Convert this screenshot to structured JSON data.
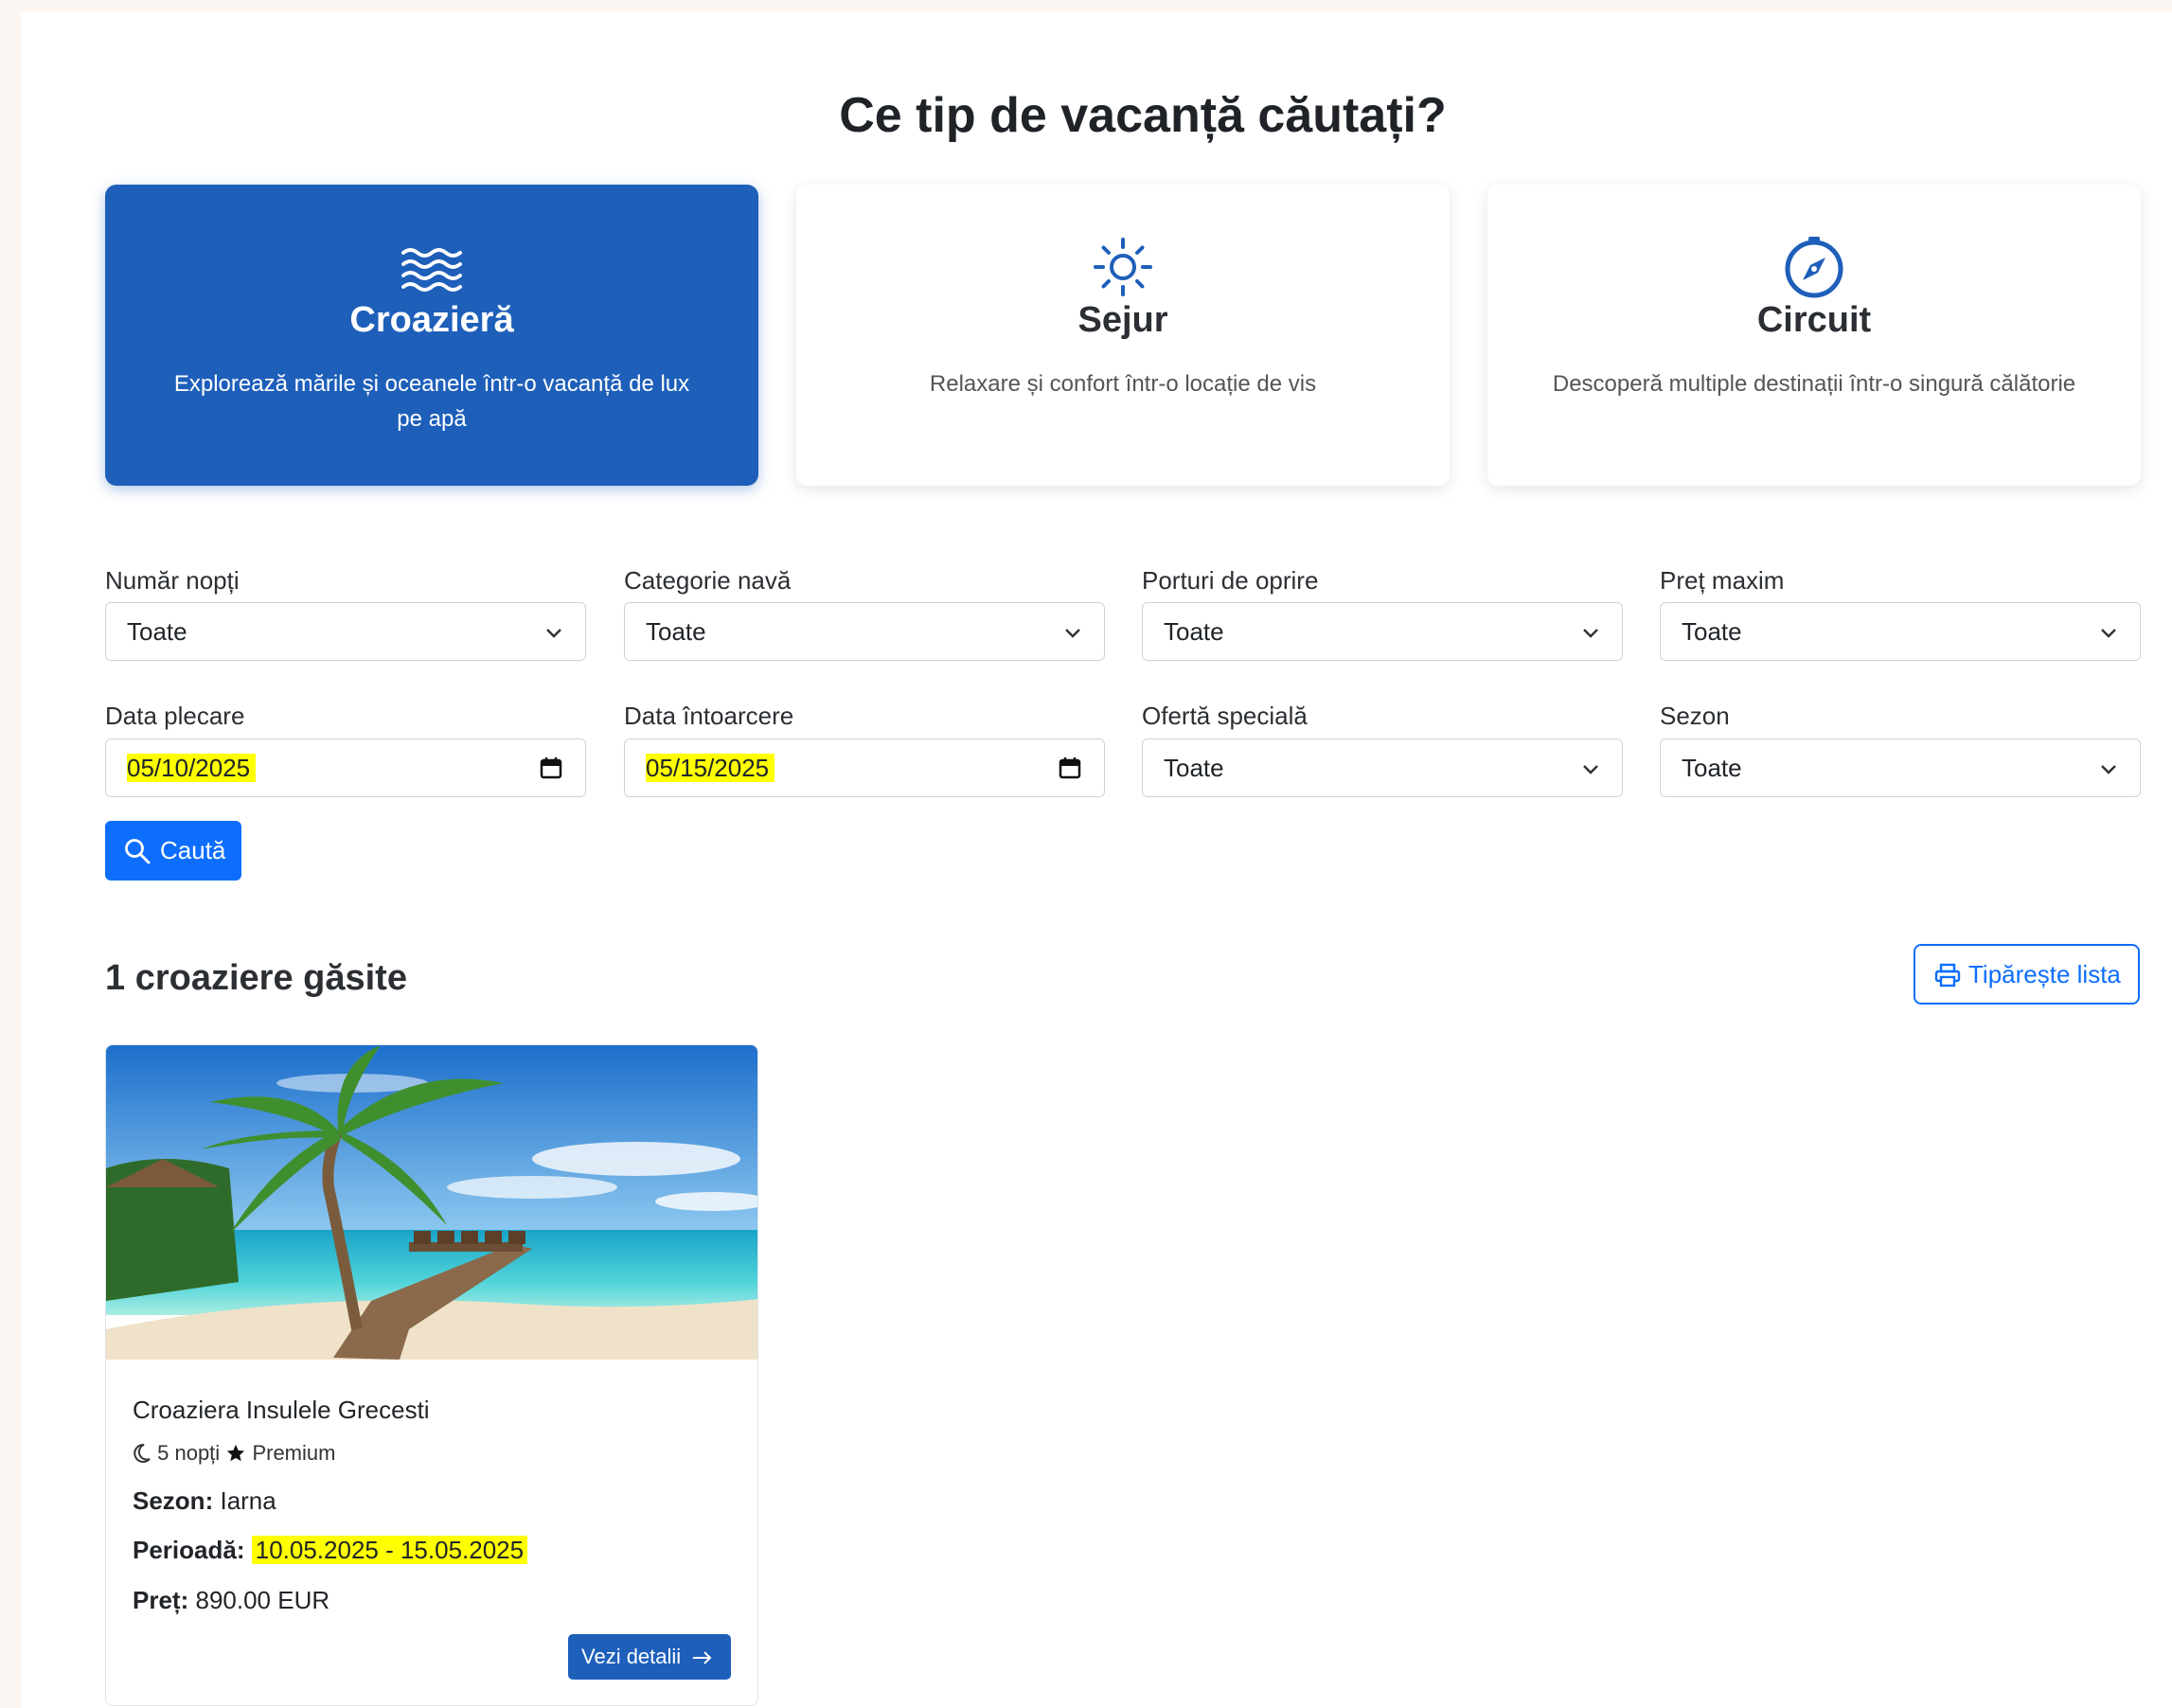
{
  "title": "Ce tip de vacanță căutați?",
  "types": [
    {
      "name": "Croazieră",
      "desc": "Explorează mările și oceanele într-o vacanță de lux pe apă",
      "icon": "waves-icon"
    },
    {
      "name": "Sejur",
      "desc": "Relaxare și confort într-o locație de vis",
      "icon": "sun-icon"
    },
    {
      "name": "Circuit",
      "desc": "Descoperă multiple destinații într-o singură călătorie",
      "icon": "compass-icon"
    }
  ],
  "filters": {
    "nights": {
      "label": "Număr nopți",
      "value": "Toate"
    },
    "ship_category": {
      "label": "Categorie navă",
      "value": "Toate"
    },
    "ports": {
      "label": "Porturi de oprire",
      "value": "Toate"
    },
    "max_price": {
      "label": "Preț maxim",
      "value": "Toate"
    },
    "departure": {
      "label": "Data plecare",
      "value": "05/10/2025"
    },
    "return": {
      "label": "Data întoarcere",
      "value": "05/15/2025"
    },
    "special_offer": {
      "label": "Ofertă specială",
      "value": "Toate"
    },
    "season": {
      "label": "Sezon",
      "value": "Toate"
    }
  },
  "search_label": "Caută",
  "results_count": "1 croaziere găsite",
  "print_label": "Tipărește lista",
  "result": {
    "title": "Croaziera Insulele Grecesti",
    "nights": "5 nopți",
    "category": "Premium",
    "season_label": "Sezon:",
    "season_value": "Iarna",
    "period_label": "Perioadă:",
    "period_value": "10.05.2025 - 15.05.2025",
    "price_label": "Preț:",
    "price_value": "890.00 EUR",
    "details_label": "Vezi detalii"
  },
  "colors": {
    "primary": "#0d6efd",
    "active_card": "#1e5fba",
    "highlight": "#ffff00"
  }
}
